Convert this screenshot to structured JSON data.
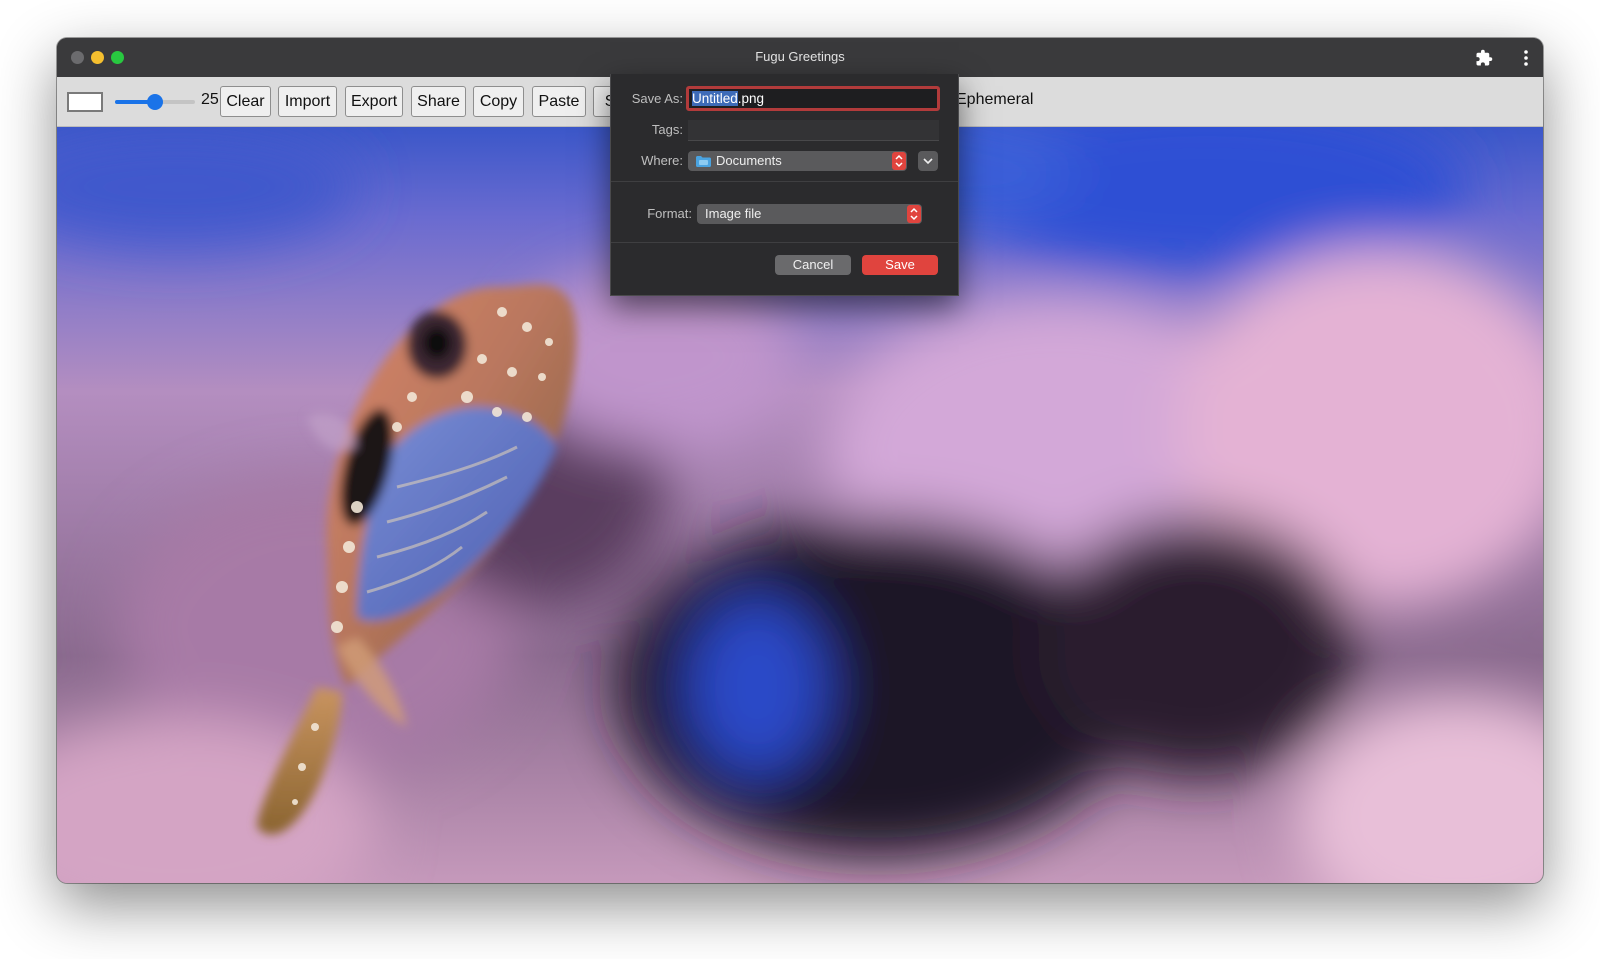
{
  "window": {
    "title": "Fugu Greetings"
  },
  "toolbar": {
    "brush_size": "25",
    "brush_size_value": 25,
    "brush_size_max": 50,
    "buttons": [
      "Clear",
      "Import",
      "Export",
      "Share",
      "Copy",
      "Paste",
      "Scan"
    ],
    "ephemeral_label": "Ephemeral"
  },
  "icons": {
    "window_controls": [
      "close-icon",
      "minimize-icon",
      "maximize-icon"
    ],
    "extensions": "puzzle-piece-icon",
    "menu": "more-vertical-icon",
    "where_folder": "folder-icon",
    "expand": "chevron-down-icon"
  },
  "dialog": {
    "save_as_label": "Save As:",
    "filename_selected": "Untitled",
    "filename_extension": ".png",
    "tags_label": "Tags:",
    "tags_value": "",
    "where_label": "Where:",
    "where_value": "Documents",
    "format_label": "Format:",
    "format_value": "Image file",
    "cancel_label": "Cancel",
    "save_label": "Save"
  },
  "colors": {
    "accent": "#e0443e",
    "slider": "#1a73e8",
    "selection": "#3d6bb8"
  }
}
